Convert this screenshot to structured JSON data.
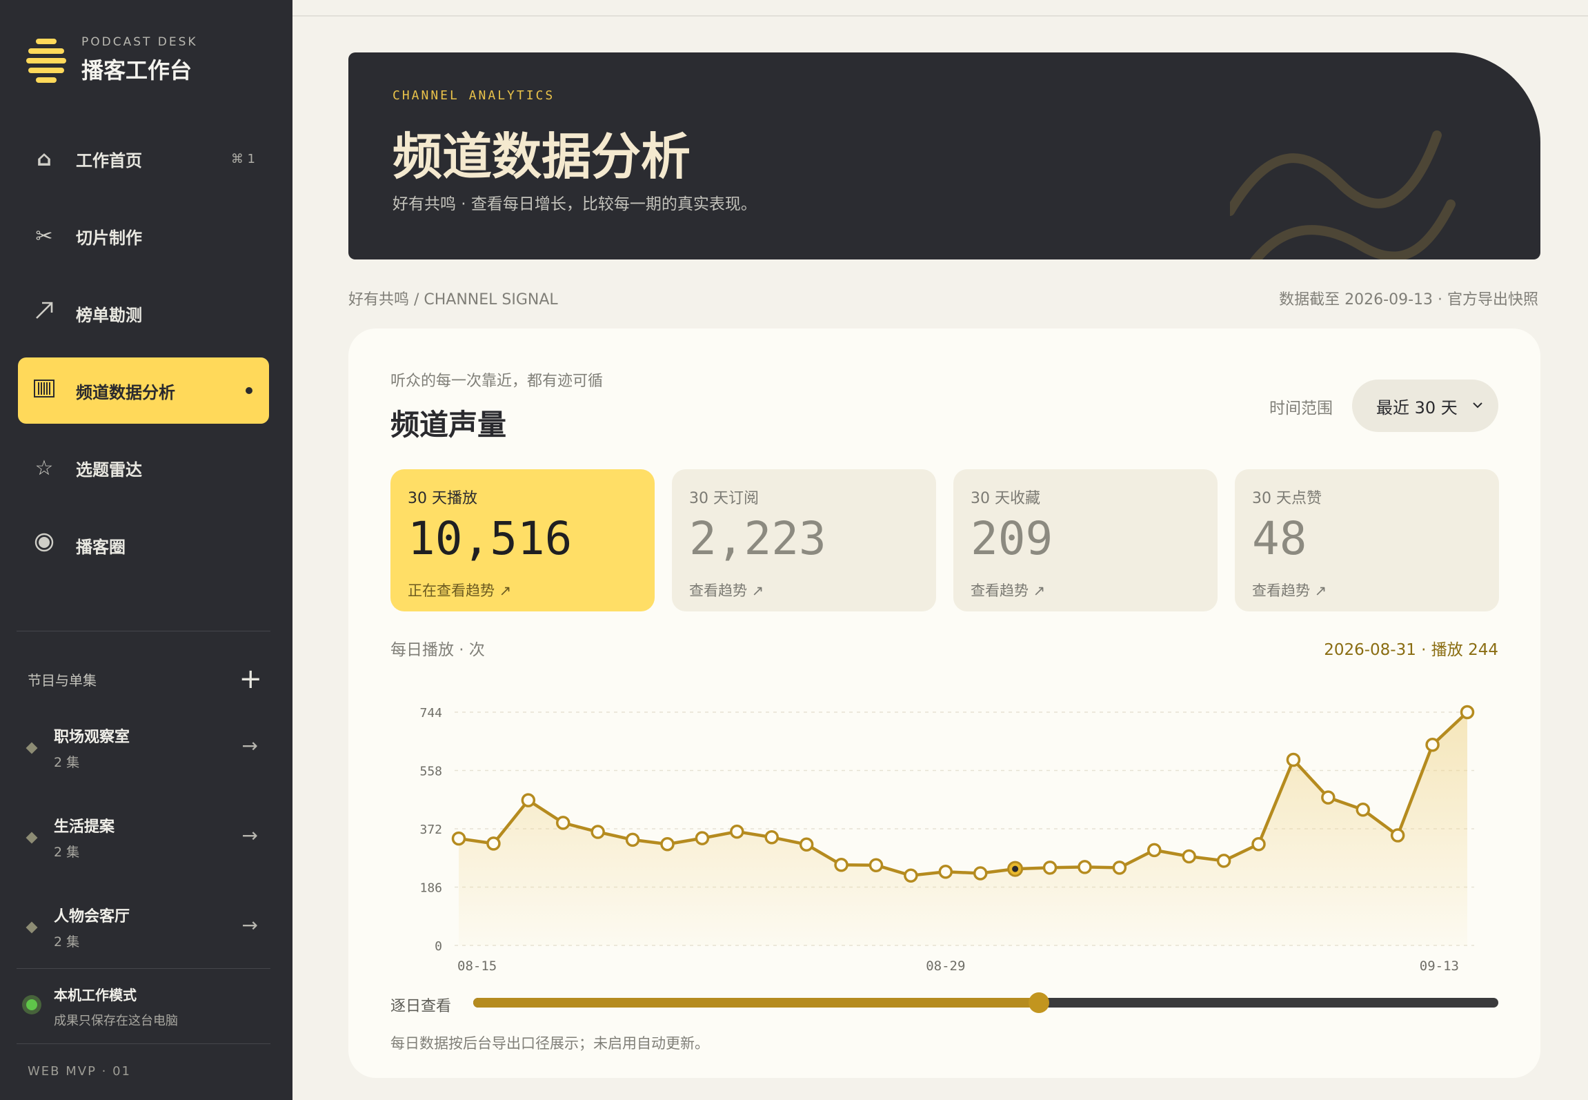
{
  "sidebar": {
    "brand_eyebrow": "PODCAST DESK",
    "brand_title": "播客工作台",
    "nav": [
      {
        "label": "工作首页",
        "icon": "home-icon",
        "shortcut": "⌘ 1"
      },
      {
        "label": "切片制作",
        "icon": "scissors-icon"
      },
      {
        "label": "榜单勘测",
        "icon": "trend-arrow-icon"
      },
      {
        "label": "频道数据分析",
        "icon": "barcode-icon",
        "active": true
      },
      {
        "label": "选题雷达",
        "icon": "star-icon"
      },
      {
        "label": "播客圈",
        "icon": "circle-icon"
      }
    ],
    "shows_title": "节目与单集",
    "shows": [
      {
        "name": "职场观察室",
        "count": "2 集"
      },
      {
        "name": "生活提案",
        "count": "2 集"
      },
      {
        "name": "人物会客厅",
        "count": "2 集"
      }
    ],
    "mode_title": "本机工作模式",
    "mode_sub": "成果只保存在这台电脑",
    "version": "WEB MVP · 01"
  },
  "hero": {
    "eyebrow": "CHANNEL ANALYTICS",
    "title": "频道数据分析",
    "subtitle": "好有共鸣 · 查看每日增长，比较每一期的真实表现。"
  },
  "breadcrumb": "好有共鸣 / CHANNEL SIGNAL",
  "snapshot": "数据截至 2026-09-13 · 官方导出快照",
  "card": {
    "kicker": "听众的每一次靠近，都有迹可循",
    "title": "频道声量",
    "range_label": "时间范围",
    "range_value": "最近 30 天"
  },
  "stats": [
    {
      "label": "30 天播放",
      "value": "10,516",
      "link": "正在查看趋势 ↗",
      "active": true
    },
    {
      "label": "30 天订阅",
      "value": "2,223",
      "link": "查看趋势 ↗"
    },
    {
      "label": "30 天收藏",
      "value": "209",
      "link": "查看趋势 ↗"
    },
    {
      "label": "30 天点赞",
      "value": "48",
      "link": "查看趋势 ↗"
    }
  ],
  "chart_label": "每日播放 · 次",
  "chart_readout": "2026-08-31 · 播放 244",
  "chart_data": {
    "type": "area",
    "ylabel": "",
    "xlabel": "",
    "y_ticks": [
      0,
      186,
      372,
      558,
      744
    ],
    "ylim": [
      0,
      744
    ],
    "x_tick_labels": [
      {
        "index": 0,
        "label": "08-15"
      },
      {
        "index": 14,
        "label": "08-29"
      },
      {
        "index": 29,
        "label": "09-13"
      }
    ],
    "x": [
      "08-15",
      "08-16",
      "08-17",
      "08-18",
      "08-19",
      "08-20",
      "08-21",
      "08-22",
      "08-23",
      "08-24",
      "08-25",
      "08-26",
      "08-27",
      "08-28",
      "08-29",
      "08-30",
      "08-31",
      "09-01",
      "09-02",
      "09-03",
      "09-04",
      "09-05",
      "09-06",
      "09-07",
      "09-08",
      "09-09",
      "09-10",
      "09-11",
      "09-12",
      "09-13"
    ],
    "values": [
      341,
      325,
      463,
      391,
      362,
      337,
      323,
      342,
      363,
      345,
      322,
      257,
      256,
      223,
      235,
      230,
      244,
      248,
      250,
      248,
      304,
      284,
      270,
      323,
      592,
      472,
      433,
      351,
      640,
      744
    ],
    "highlight_index": 16,
    "grid": "horizontal-dashed",
    "color": "#b58b1f"
  },
  "slider": {
    "label": "逐日查看",
    "value_fraction": 0.552
  },
  "footnote": "每日数据按后台导出口径展示；未启用自动更新。"
}
